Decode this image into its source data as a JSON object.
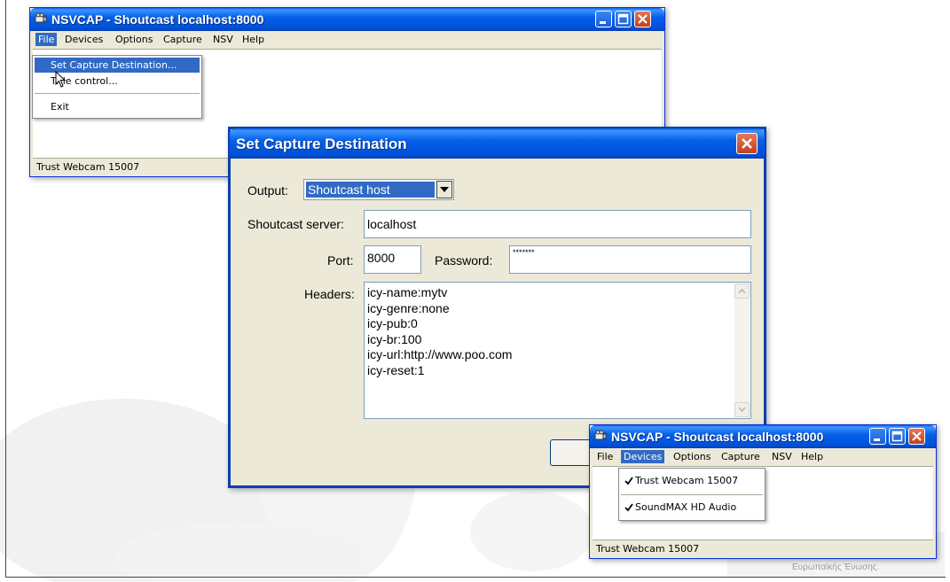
{
  "main_window": {
    "title": "NSVCAP - Shoutcast localhost:8000",
    "menu": [
      "File",
      "Devices",
      "Options",
      "Capture",
      "NSV",
      "Help"
    ],
    "status": "Trust Webcam 15007"
  },
  "file_menu": {
    "items": [
      "Set Capture Destination...",
      "Title control...",
      "Exit"
    ]
  },
  "dialog": {
    "title": "Set Capture Destination",
    "output_label": "Output:",
    "output_value": "Shoutcast host",
    "server_label": "Shoutcast server:",
    "server_value": "localhost",
    "port_label": "Port:",
    "port_value": "8000",
    "password_label": "Password:",
    "password_value": "*******",
    "headers_label": "Headers:",
    "headers_lines": [
      "icy-name:mytv",
      "icy-genre:none",
      "icy-pub:0",
      "icy-br:100",
      "icy-url:http://www.poo.com",
      "icy-reset:1"
    ]
  },
  "second_window": {
    "title": "NSVCAP - Shoutcast localhost:8000",
    "menu": [
      "File",
      "Devices",
      "Options",
      "Capture",
      "NSV",
      "Help"
    ],
    "status": "Trust Webcam 15007"
  },
  "devices_menu": {
    "items": [
      "Trust Webcam 15007",
      "SoundMAX HD Audio"
    ]
  },
  "footer": {
    "text": "Ευρωπαϊκής Ένωσης."
  }
}
